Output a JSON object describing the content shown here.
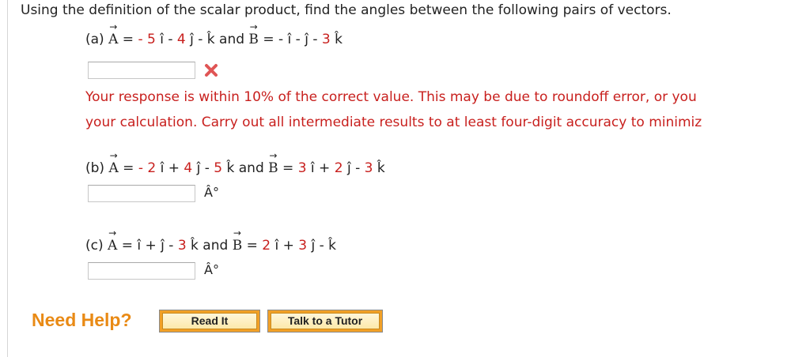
{
  "question": {
    "intro": "Using the definition of the scalar product, find the angles between the following pairs of vectors."
  },
  "parts": [
    {
      "label": "(a)",
      "vecA": "A",
      "vecB": "B",
      "eq": " = ",
      "and": " and ",
      "a_terms": [
        "- 5",
        " î - ",
        "4",
        " ĵ - k̂"
      ],
      "b_terms": [
        "- î - ĵ - ",
        "3",
        " k̂"
      ],
      "input_value": "",
      "status": "incorrect",
      "feedback_lines": [
        "Your response is within 10% of the correct value. This may be due to roundoff error, or you",
        "your calculation. Carry out all intermediate results to at least four-digit accuracy to minimiz"
      ]
    },
    {
      "label": "(b)",
      "vecA": "A",
      "vecB": "B",
      "eq": " = ",
      "and": " and ",
      "a_terms": [
        "- 2",
        " î + ",
        "4",
        " ĵ - ",
        "5",
        " k̂"
      ],
      "b_terms": [
        "3",
        " î + ",
        "2",
        " ĵ - ",
        "3",
        " k̂"
      ],
      "input_value": "",
      "unit": "Â°"
    },
    {
      "label": "(c)",
      "vecA": "A",
      "vecB": "B",
      "eq": " = ",
      "and": " and ",
      "a_terms": [
        "î + ĵ - ",
        "3",
        " k̂"
      ],
      "b_terms": [
        "2",
        " î + ",
        "3",
        " ĵ - k̂"
      ],
      "input_value": "",
      "unit": "Â°"
    }
  ],
  "help": {
    "label": "Need Help?",
    "read_it": "Read It",
    "talk_to_tutor": "Talk to a Tutor"
  },
  "colors": {
    "accent_red": "#c8201e",
    "help_orange": "#e98a15",
    "button_fill": "#f1a027"
  },
  "icons": {
    "incorrect": "x-mark-icon"
  }
}
